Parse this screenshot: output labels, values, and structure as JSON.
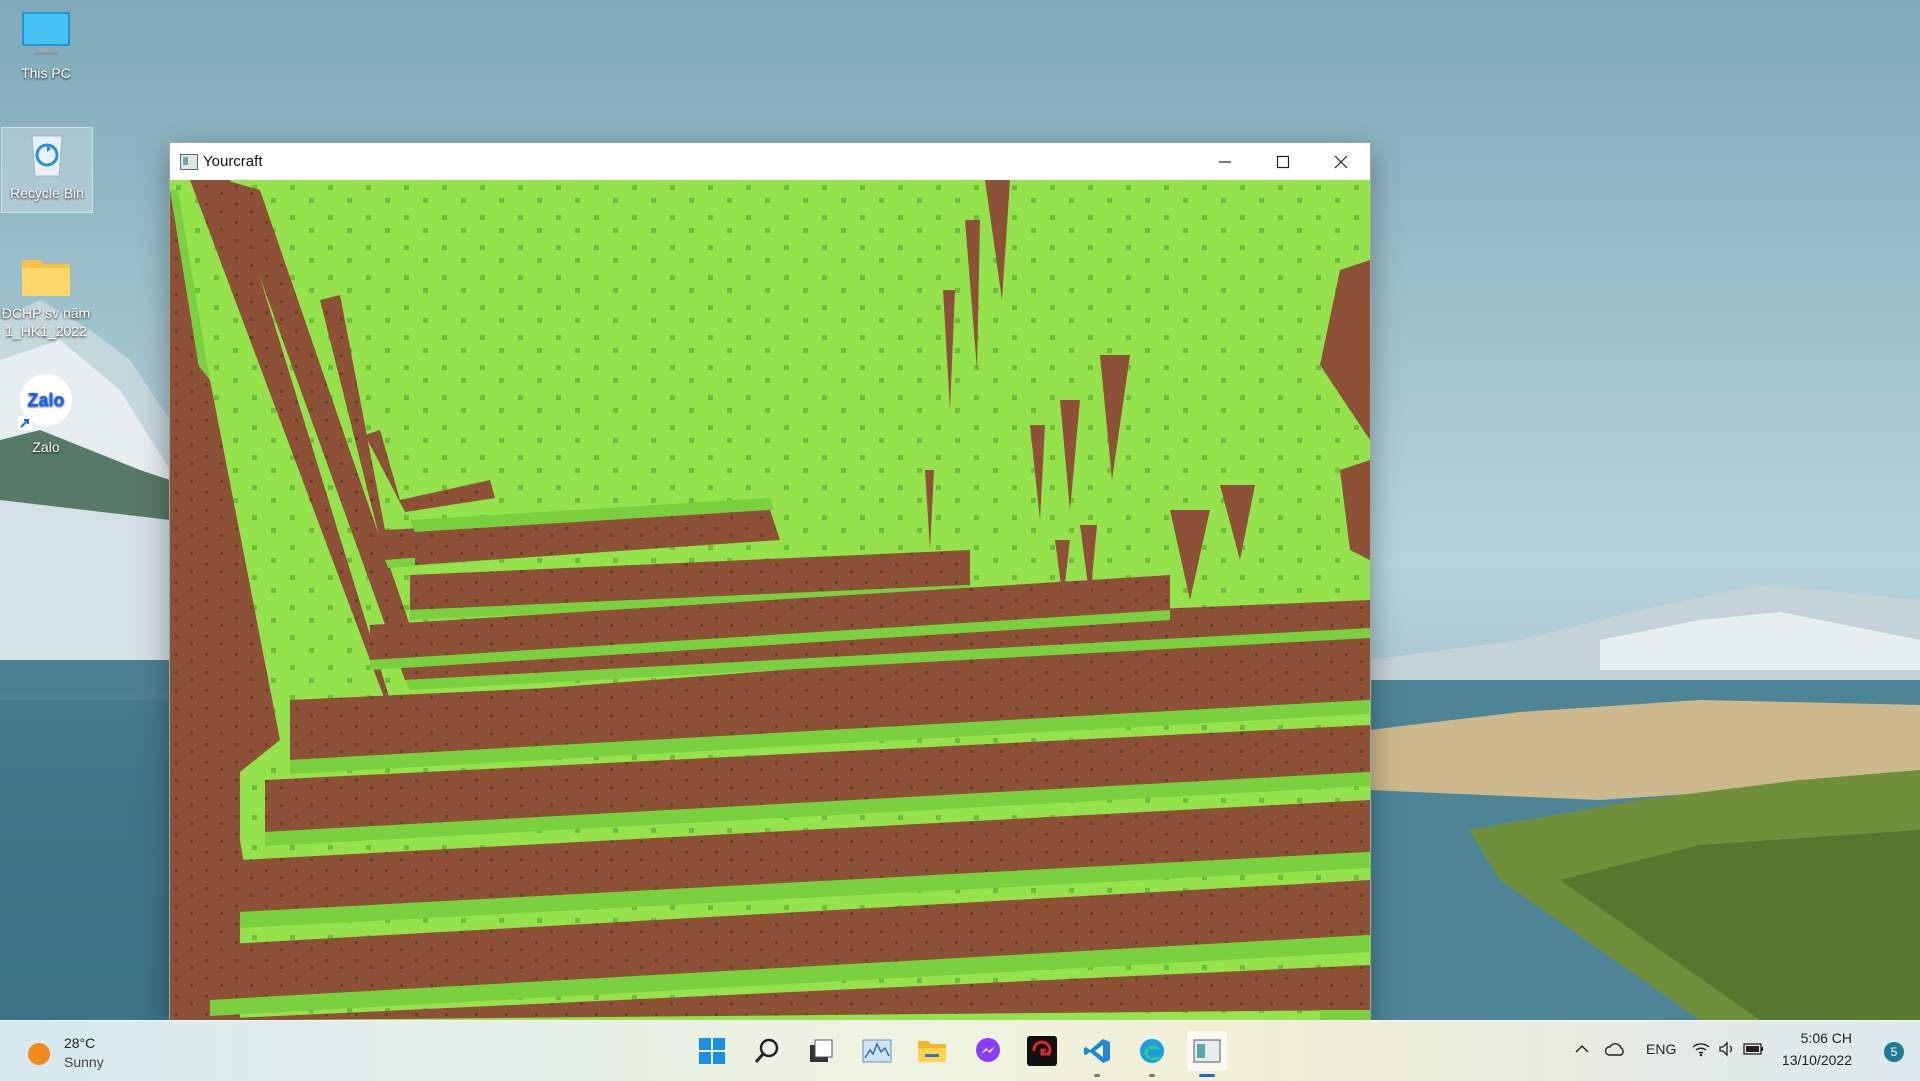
{
  "desktop": {
    "icons": [
      {
        "label": "This PC",
        "icon": "monitor-icon"
      },
      {
        "label": "Recycle Bin",
        "icon": "recycle-bin-icon"
      },
      {
        "label": "ĐCHP sv năm 1_HK1_2022",
        "icon": "folder-icon"
      },
      {
        "label": "Zalo",
        "icon": "zalo-icon",
        "badge_text": "Zalo"
      }
    ]
  },
  "window": {
    "title": "Yourcraft",
    "icon": "app-window-icon",
    "controls": {
      "minimize": "minimize-icon",
      "maximize": "maximize-icon",
      "close": "close-icon"
    }
  },
  "game": {
    "grass_color": "#94e34c",
    "dirt_color": "#8c5136",
    "grass_dark": "#6fbd3a"
  },
  "taskbar": {
    "weather": {
      "temperature": "28°C",
      "condition": "Sunny",
      "icon": "sun-icon"
    },
    "apps": [
      {
        "name": "start-button",
        "icon": "windows-logo-icon",
        "running": false
      },
      {
        "name": "search-button",
        "icon": "search-icon",
        "running": false
      },
      {
        "name": "task-view-button",
        "icon": "task-view-icon",
        "running": false
      },
      {
        "name": "resource-monitor-button",
        "icon": "chart-icon",
        "running": false
      },
      {
        "name": "file-explorer-button",
        "icon": "folder-icon",
        "running": false
      },
      {
        "name": "messenger-button",
        "icon": "messenger-icon",
        "running": false
      },
      {
        "name": "garena-button",
        "icon": "garena-icon",
        "running": false
      },
      {
        "name": "vscode-button",
        "icon": "vscode-icon",
        "running": true
      },
      {
        "name": "edge-button",
        "icon": "edge-icon",
        "running": true
      },
      {
        "name": "yourcraft-button",
        "icon": "app-window-icon",
        "running": true,
        "active": true
      }
    ],
    "tray": {
      "language": "ENG",
      "time": "5:06 CH",
      "date": "13/10/2022",
      "notification_count": "5"
    }
  }
}
